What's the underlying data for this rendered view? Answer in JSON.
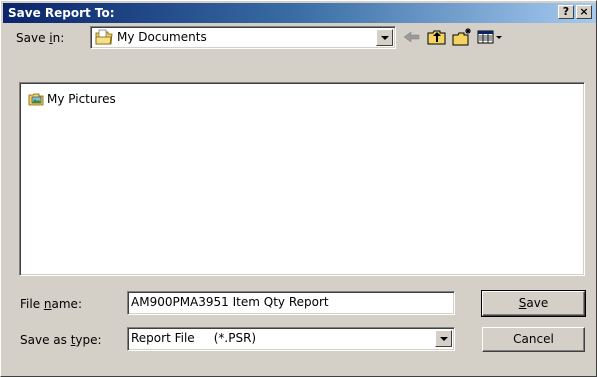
{
  "window": {
    "title": "Save Report To:",
    "help_label": "?",
    "close_label": "×"
  },
  "save_in": {
    "label_pre": "Save ",
    "label_ul": "i",
    "label_post": "n:",
    "value": "My Documents",
    "icon": "documents-folder-icon"
  },
  "toolbar": {
    "back_icon": "back-arrow-icon",
    "up_icon": "up-folder-icon",
    "new_folder_icon": "new-folder-icon",
    "view_menu_icon": "view-menu-icon"
  },
  "file_list": {
    "items": [
      {
        "label": "My Pictures",
        "icon": "pictures-folder-icon"
      }
    ]
  },
  "file_name": {
    "label_pre": "File ",
    "label_ul": "n",
    "label_post": "ame:",
    "value": "AM900PMA3951 Item Qty Report"
  },
  "save_type": {
    "label_pre": "Save as ",
    "label_ul": "t",
    "label_post": "ype:",
    "value": "Report File     (*.PSR)"
  },
  "buttons": {
    "save_ul": "S",
    "save_rest": "ave",
    "cancel": "Cancel"
  },
  "colors": {
    "title_gradient_start": "#0a246a",
    "title_gradient_end": "#a6caf0",
    "face": "#d4d0c8"
  }
}
